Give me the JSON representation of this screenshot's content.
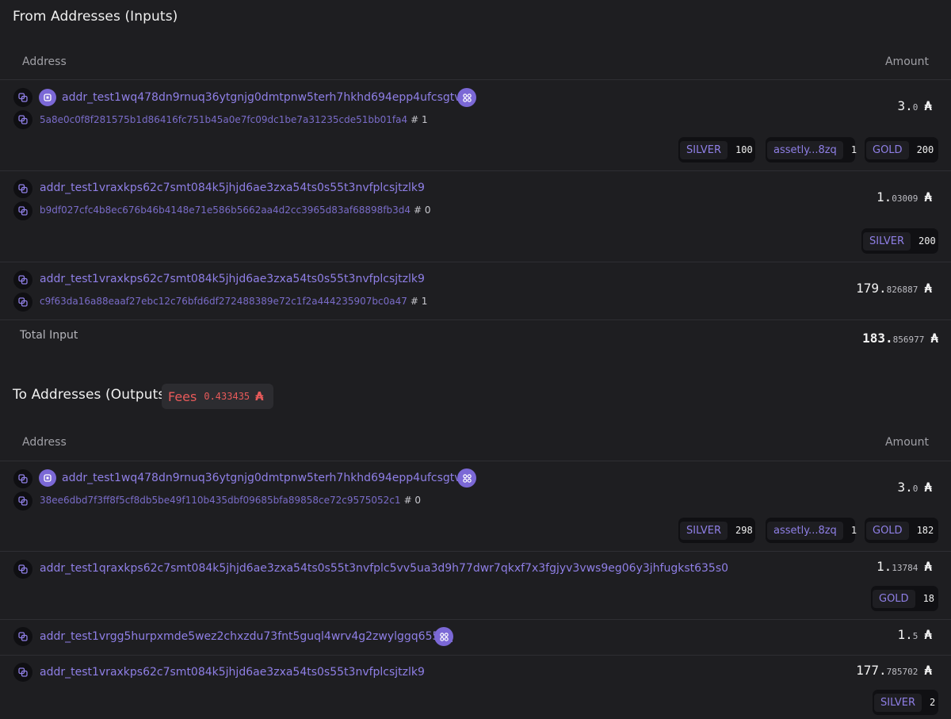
{
  "inputs": {
    "title": "From Addresses (Inputs)",
    "col_address": "Address",
    "col_amount": "Amount",
    "rows": [
      {
        "address": "addr_test1wq478dn9rnuq36ytgnjg0dmtpnw5terh7hkhd694epp4ufcsgtvc2",
        "tx_hash": "5a8e0c0f8f281575b1d86416fc751b45a0e7fc09dc1be7a31235cde51bb01fa4",
        "index": "# 1",
        "amount_int": "3.",
        "amount_dec": "0",
        "assets": [
          {
            "name": "SILVER",
            "qty": "100"
          },
          {
            "name": "assetly...8zq",
            "qty": "1"
          },
          {
            "name": "GOLD",
            "qty": "200"
          }
        ]
      },
      {
        "address": "addr_test1vraxkps62c7smt084k5jhjd6ae3zxa54ts0s55t3nvfplcsjtzlk9",
        "tx_hash": "b9df027cfc4b8ec676b46b4148e71e586b5662aa4d2cc3965d83af68898fb3d4",
        "index": "# 0",
        "amount_int": "1.",
        "amount_dec": "03009",
        "assets": [
          {
            "name": "SILVER",
            "qty": "200"
          }
        ]
      },
      {
        "address": "addr_test1vraxkps62c7smt084k5jhjd6ae3zxa54ts0s55t3nvfplcsjtzlk9",
        "tx_hash": "c9f63da16a88eaaf27ebc12c76bfd6df272488389e72c1f2a444235907bc0a47",
        "index": "# 1",
        "amount_int": "179.",
        "amount_dec": "826887"
      }
    ],
    "total_label": "Total Input",
    "total_int": "183.",
    "total_dec": "856977"
  },
  "outputs": {
    "title": "To Addresses (Outputs)",
    "fees_label": "Fees",
    "fees_value": "0.433435",
    "col_address": "Address",
    "col_amount": "Amount",
    "rows": [
      {
        "address": "addr_test1wq478dn9rnuq36ytgnjg0dmtpnw5terh7hkhd694epp4ufcsgtvc2",
        "tx_hash": "38ee6dbd7f3ff8f5cf8db5be49f110b435dbf09685bfa89858ce72c9575052c1",
        "index": "# 0",
        "amount_int": "3.",
        "amount_dec": "0",
        "assets": [
          {
            "name": "SILVER",
            "qty": "298"
          },
          {
            "name": "assetly...8zq",
            "qty": "1"
          },
          {
            "name": "GOLD",
            "qty": "182"
          }
        ]
      },
      {
        "address": "addr_test1qraxkps62c7smt084k5jhjd6ae3zxa54ts0s55t3nvfplc5vv5ua3d9h77dwr7qkxf7x3fgjyv3vws9eg06y3jhfugkst635s0",
        "amount_int": "1.",
        "amount_dec": "13784",
        "assets": [
          {
            "name": "GOLD",
            "qty": "18"
          }
        ]
      },
      {
        "address": "addr_test1vrgg5hurpxmde5wez2chxzdu73fnt5guql4wrv4g2zwylggq655pq",
        "amount_int": "1.",
        "amount_dec": "5"
      },
      {
        "address": "addr_test1vraxkps62c7smt084k5jhjd6ae3zxa54ts0s55t3nvfplcsjtzlk9",
        "amount_int": "177.",
        "amount_dec": "785702",
        "assets": [
          {
            "name": "SILVER",
            "qty": "2"
          }
        ]
      }
    ]
  },
  "ada_symbol": "₳",
  "icons": {
    "copy": "copy-icon",
    "script": "script-icon",
    "token": "token-icon"
  },
  "colors": {
    "background": "#1e1e21",
    "accent": "#8f7fe6",
    "badge": "#7b68d6",
    "fees": "#e85a5a"
  }
}
